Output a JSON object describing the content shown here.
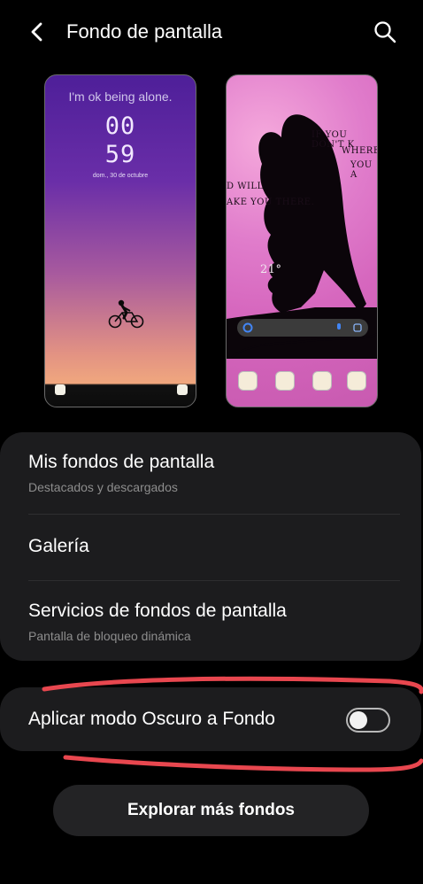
{
  "header": {
    "title": "Fondo de pantalla",
    "back_icon": "back-arrow-icon",
    "search_icon": "search-icon"
  },
  "previews": {
    "lock": {
      "quote": "I'm ok being alone.",
      "hour": "00",
      "minute": "59",
      "date": "dom., 30 de octubre"
    },
    "home": {
      "text_right_1": "IF YOU DON'T K",
      "text_right_2": "WHERE",
      "text_right_3": "YOU A",
      "text_left_1": "D WILL",
      "text_left_2": "AKE YOU THERE.",
      "weather": "21°"
    }
  },
  "options": [
    {
      "title": "Mis fondos de pantalla",
      "subtitle": "Destacados y descargados"
    },
    {
      "title": "Galería",
      "subtitle": ""
    },
    {
      "title": "Servicios de fondos de pantalla",
      "subtitle": "Pantalla de bloqueo dinámica"
    }
  ],
  "dark_mode": {
    "label": "Aplicar modo Oscuro a Fondo",
    "enabled": false
  },
  "explore_button": "Explorar más fondos",
  "colors": {
    "accent_scribble": "#e8474f",
    "card_bg": "#1c1c1e",
    "background": "#000000"
  }
}
